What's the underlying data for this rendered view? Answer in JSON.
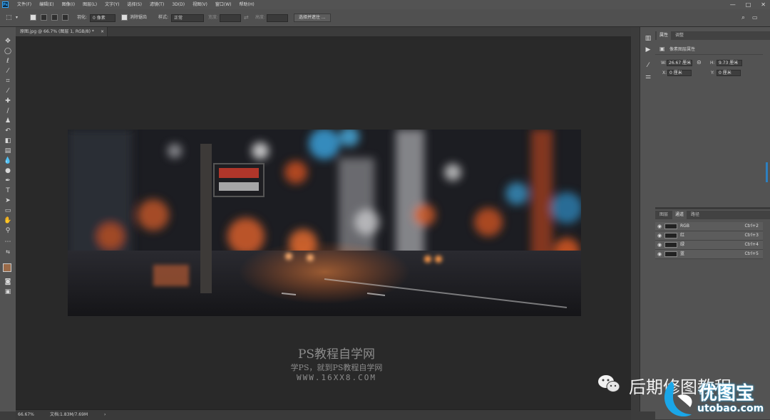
{
  "menubar": {
    "logo": "Ps",
    "items": [
      "文件(F)",
      "编辑(E)",
      "图像(I)",
      "图层(L)",
      "文字(Y)",
      "选择(S)",
      "滤镜(T)",
      "3D(D)",
      "视图(V)",
      "窗口(W)",
      "帮助(H)"
    ],
    "controls": [
      "—",
      "□",
      "✕"
    ]
  },
  "options": {
    "feather_label": "羽化:",
    "feather_value": "0 像素",
    "antialias_label": "消除锯齿",
    "style_label": "样式:",
    "style_value": "正常",
    "width_label": "宽度:",
    "height_label": "高度:",
    "select_mask_btn": "选择并遮住 ..."
  },
  "document": {
    "tab_title": "原图.jpg @ 66.7% (图层 1, RGB/8) *",
    "close": "×"
  },
  "status": {
    "zoom": "66.67%",
    "doc_info": "文档:1.83M/7.69M",
    "arrow": "›"
  },
  "properties_panel": {
    "tabs": [
      "属性",
      "调整"
    ],
    "header": "像素图层属性",
    "w_label": "W:",
    "w_value": "26.67 厘米",
    "link": "⊝",
    "h_label": "H:",
    "h_value": "9.73 厘米",
    "x_label": "X:",
    "x_value": "0 厘米",
    "y_label": "Y:",
    "y_value": "0 厘米"
  },
  "channels_panel": {
    "tabs": [
      "图层",
      "通道",
      "路径"
    ],
    "rows": [
      {
        "name": "RGB",
        "key": "Ctrl+2"
      },
      {
        "name": "红",
        "key": "Ctrl+3"
      },
      {
        "name": "绿",
        "key": "Ctrl+4"
      },
      {
        "name": "蓝",
        "key": "Ctrl+5"
      }
    ]
  },
  "watermark": {
    "title": "PS教程自学网",
    "subtitle": "学PS，就到PS教程自学网",
    "url": "WWW.16XX8.COM",
    "wechat": "后期修图教程",
    "brand": "优图宝",
    "brand_url": "utobao.com"
  },
  "colors": {
    "accent": "#31a8ff",
    "brand_blue": "#1aa6e8",
    "canvas_bg": "#292929",
    "panel_bg": "#535353"
  }
}
